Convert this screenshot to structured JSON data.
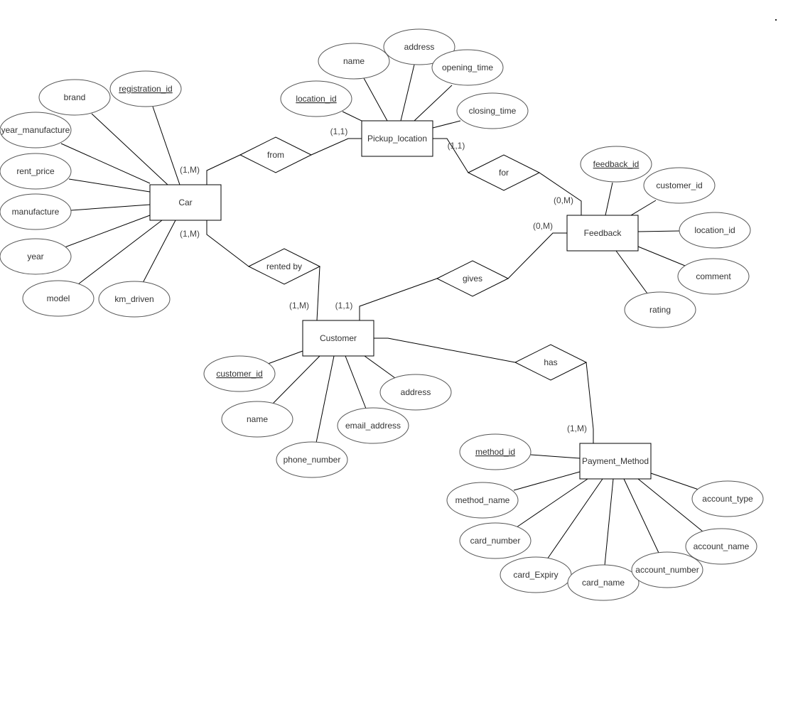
{
  "diagram": {
    "type": "er-diagram",
    "entities": [
      {
        "id": "car",
        "label": "Car"
      },
      {
        "id": "pickup",
        "label": "Pickup_location"
      },
      {
        "id": "feedback",
        "label": "Feedback"
      },
      {
        "id": "customer",
        "label": "Customer"
      },
      {
        "id": "payment",
        "label": "Payment_Method"
      }
    ],
    "relationships": [
      {
        "id": "from",
        "label": "from",
        "connects": [
          "car",
          "pickup"
        ],
        "cardinalities": [
          "(1,M)",
          "(1,1)"
        ]
      },
      {
        "id": "for",
        "label": "for",
        "connects": [
          "pickup",
          "feedback"
        ],
        "cardinalities": [
          "(1,1)",
          "(0,M)"
        ]
      },
      {
        "id": "rented_by",
        "label": "rented by",
        "connects": [
          "car",
          "customer"
        ],
        "cardinalities": [
          "(1,M)",
          "(1,M)"
        ]
      },
      {
        "id": "gives",
        "label": "gives",
        "connects": [
          "customer",
          "feedback"
        ],
        "cardinalities": [
          "(1,1)",
          "(0,M)"
        ]
      },
      {
        "id": "has",
        "label": "has",
        "connects": [
          "customer",
          "payment"
        ],
        "cardinalities": [
          "",
          "(1,M)"
        ]
      }
    ],
    "attributes": [
      {
        "id": "car_registration_id",
        "entity": "car",
        "label": "registration_id",
        "key": true
      },
      {
        "id": "car_brand",
        "entity": "car",
        "label": "brand",
        "key": false
      },
      {
        "id": "car_year_manufacture",
        "entity": "car",
        "label": "year_manufacture",
        "key": false
      },
      {
        "id": "car_rent_price",
        "entity": "car",
        "label": "rent_price",
        "key": false
      },
      {
        "id": "car_manufacture",
        "entity": "car",
        "label": "manufacture",
        "key": false
      },
      {
        "id": "car_year",
        "entity": "car",
        "label": "year",
        "key": false
      },
      {
        "id": "car_model",
        "entity": "car",
        "label": "model",
        "key": false
      },
      {
        "id": "car_km_driven",
        "entity": "car",
        "label": "km_driven",
        "key": false
      },
      {
        "id": "pl_location_id",
        "entity": "pickup",
        "label": "location_id",
        "key": true
      },
      {
        "id": "pl_name",
        "entity": "pickup",
        "label": "name",
        "key": false
      },
      {
        "id": "pl_address",
        "entity": "pickup",
        "label": "address",
        "key": false
      },
      {
        "id": "pl_opening_time",
        "entity": "pickup",
        "label": "opening_time",
        "key": false
      },
      {
        "id": "pl_closing_time",
        "entity": "pickup",
        "label": "closing_time",
        "key": false
      },
      {
        "id": "fb_feedback_id",
        "entity": "feedback",
        "label": "feedback_id",
        "key": true
      },
      {
        "id": "fb_customer_id",
        "entity": "feedback",
        "label": "customer_id",
        "key": false
      },
      {
        "id": "fb_location_id",
        "entity": "feedback",
        "label": "location_id",
        "key": false
      },
      {
        "id": "fb_comment",
        "entity": "feedback",
        "label": "comment",
        "key": false
      },
      {
        "id": "fb_rating",
        "entity": "feedback",
        "label": "rating",
        "key": false
      },
      {
        "id": "cu_customer_id",
        "entity": "customer",
        "label": "customer_id",
        "key": true
      },
      {
        "id": "cu_name",
        "entity": "customer",
        "label": "name",
        "key": false
      },
      {
        "id": "cu_phone_number",
        "entity": "customer",
        "label": "phone_number",
        "key": false
      },
      {
        "id": "cu_email_address",
        "entity": "customer",
        "label": "email_address",
        "key": false
      },
      {
        "id": "cu_address",
        "entity": "customer",
        "label": "address",
        "key": false
      },
      {
        "id": "pm_method_id",
        "entity": "payment",
        "label": "method_id",
        "key": true
      },
      {
        "id": "pm_method_name",
        "entity": "payment",
        "label": "method_name",
        "key": false
      },
      {
        "id": "pm_card_number",
        "entity": "payment",
        "label": "card_number",
        "key": false
      },
      {
        "id": "pm_card_expiry",
        "entity": "payment",
        "label": "card_Expiry",
        "key": false
      },
      {
        "id": "pm_card_name",
        "entity": "payment",
        "label": "card_name",
        "key": false
      },
      {
        "id": "pm_account_number",
        "entity": "payment",
        "label": "account_number",
        "key": false
      },
      {
        "id": "pm_account_name",
        "entity": "payment",
        "label": "account_name",
        "key": false
      },
      {
        "id": "pm_account_type",
        "entity": "payment",
        "label": "account_type",
        "key": false
      }
    ]
  }
}
